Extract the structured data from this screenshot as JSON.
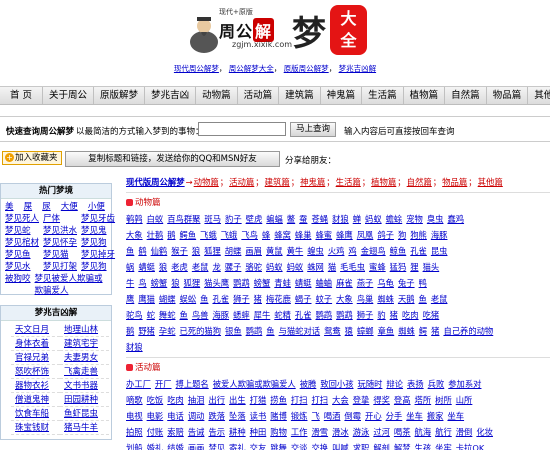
{
  "header": {
    "logo_tagline": "现代+原版",
    "logo_name_a": "周公",
    "logo_name_b": "解",
    "logo_meng": "梦",
    "logo_url": "zgjm.xixik.com",
    "seal_text_1": "大",
    "seal_text_2": "全",
    "subnav": [
      "现代周公解梦",
      "周公解梦大全",
      "原版周公解梦",
      "梦兆吉凶解"
    ],
    "subnav_sep": "，"
  },
  "nav": {
    "items": [
      "首 页",
      "关于周公",
      "原版解梦",
      "梦兆吉凶",
      "动物篇",
      "活动篇",
      "建筑篇",
      "神鬼篇",
      "生活篇",
      "植物篇",
      "自然篇",
      "物品篇",
      "其他篇"
    ]
  },
  "search": {
    "label": "快速查询周公解梦",
    "description": "以最简洁的方式输入梦到的事物：",
    "input_value": "",
    "button_label": "马上查询",
    "tip": "输入内容后可直接按回车查询"
  },
  "actions": {
    "favorite_plus": "+",
    "favorite_label": "加入收藏夹",
    "copy_label": "复制标题和链接，发送给你的QQ和MSN好友",
    "share_label": "分享给朋友："
  },
  "sidebar": {
    "hot_title": "热门梦境",
    "hot_items": [
      "美",
      "屎",
      "尿",
      "大便",
      "小便",
      "梦见死人",
      "尸体",
      "梦见牙齿",
      "梦见蛇",
      "梦见洪水",
      "梦见鬼",
      "梦见棺材",
      "梦见怀孕",
      "梦见狗",
      "梦见鱼",
      "梦见猫",
      "梦见掉牙",
      "梦见水",
      "梦见打架",
      "梦见狗",
      "被狗咬",
      "梦见被爱人欺骗或欺骗爱人"
    ],
    "omen_title": "梦兆吉凶解",
    "omen_items": [
      "天文日月",
      "地理山林",
      "身体衣着",
      "建筑宅宇",
      "官禄兄弟",
      "夫妻男女",
      "怒吹杯饰",
      "飞禽走兽",
      "器物衣衫",
      "文书书器",
      "僧道鬼神",
      "田园耕种",
      "饮食车船",
      "鱼虾昆虫",
      "珠宝钱财",
      "猪马牛羊"
    ]
  },
  "main": {
    "top_heading": "现代版周公解梦",
    "top_arrow": "→",
    "top_links": [
      "动物篇",
      "活动篇",
      "建筑篇",
      "神鬼篇",
      "生活篇",
      "植物篇",
      "自然篇",
      "物品篇",
      "其他篇"
    ],
    "top_sep": "；",
    "animal_title": "动物篇",
    "animal_rows": [
      [
        "鹌鹑",
        "白蚁",
        "百鸟群聚",
        "斑马",
        "豹子",
        "壁虎",
        "蝙蝠",
        "鳖",
        "蚕",
        "苍蝇",
        "豺狼",
        "蝉",
        "蚂蚁",
        "蟾蜍",
        "宠物",
        "臭虫",
        "蠢鸡"
      ],
      [
        "大象",
        "壮鹅",
        "鹅",
        "鳄鱼",
        "飞蛾",
        "飞蛾",
        "飞鸟",
        "蜂",
        "蜂窝",
        "蜂巢",
        "蜂蜜",
        "蜂鹰",
        "凤凰",
        "鸽子",
        "狗",
        "狗熊",
        "海豚"
      ],
      [
        "鱼",
        "鹤",
        "仙鹤",
        "猴子",
        "狼",
        "狐狸",
        "胡蝶",
        "画眉",
        "黄鼠",
        "黄牛",
        "蝗虫",
        "火鸡",
        "鸡",
        "金翅鸟",
        "鲸鱼",
        "孔雀",
        "昆虫"
      ],
      [
        "蜗",
        "蜻蜓",
        "狼",
        "老虎",
        "老鼠",
        "龙",
        "骡子",
        "骆驼",
        "蚂蚁",
        "蚂蚁",
        "蛛网",
        "猫",
        "毛毛虫",
        "蜜蜂",
        "猛犸",
        "狸",
        "猫头"
      ],
      [
        "牛",
        "鸟",
        "螃蟹",
        "狼",
        "狐狸",
        "猫头鹰",
        "鹦鹉",
        "螃蟹",
        "青蛙",
        "蜻蜓",
        "蛐蛐",
        "麻雀",
        "燕子",
        "乌龟",
        "兔子",
        "鸭"
      ],
      [
        "鹰",
        "鹰猫",
        "蝴蝶",
        "蜈蚣",
        "鱼",
        "孔雀",
        "狮子",
        "猪",
        "梅花鹿",
        "蝎子",
        "蚊子",
        "大象",
        "鸟巢",
        "蜘蛛",
        "天鹅",
        "鱼",
        "老鼠"
      ],
      [
        "驼鸟",
        "蛇",
        "舞蛇",
        "鱼",
        "鸟兽",
        "海豚",
        "蟋蟀",
        "犀牛",
        "蛇精",
        "孔雀",
        "鹦鹉",
        "鹦鹉",
        "狮子",
        "豹",
        "猪",
        "吃肉",
        "吃猪"
      ],
      [
        "鹅",
        "野猪",
        "孕蛇",
        "已死的猫狗",
        "银鱼",
        "鹦鹉",
        "鱼",
        "与猫蛇对话",
        "鸳鸯",
        "猿",
        "蟑螂",
        "章鱼",
        "蜘蛛",
        "鳄",
        "猪",
        "自己养的动物"
      ],
      [
        "豺狼"
      ]
    ],
    "activity_title": "活动篇",
    "activity_rows": [
      [
        "办工厂",
        "开厂",
        "搏上题名",
        "被爱人欺骗或欺骗爱人",
        "被腾",
        "致回小孩",
        "玩随时",
        "辩论",
        "表扬",
        "兵败",
        "参加系对"
      ],
      [
        "嘀歌",
        "吃饭",
        "吃肉",
        "抽泪",
        "出行",
        "出生",
        "打猎",
        "捞鱼",
        "打扫",
        "打扫",
        "大会",
        "登挚",
        "得奖",
        "登高",
        "塔所",
        "树所",
        "山所"
      ],
      [
        "电视",
        "电影",
        "电话",
        "调动",
        "跌落",
        "坠落",
        "读书",
        "赌博",
        "锻炼",
        "飞",
        "喝酒",
        "倒霉",
        "开心",
        "分手",
        "坐车",
        "搬家",
        "坐车"
      ],
      [
        "拍照",
        "付账",
        "索赔",
        "告诫",
        "告示",
        "耕种",
        "种田",
        "购物",
        "工作",
        "滑雪",
        "滑冰",
        "游泳",
        "过河",
        "喝茶",
        "航海",
        "航行",
        "滑倒",
        "化妆"
      ],
      [
        "划船",
        "婚礼",
        "结婚",
        "画画",
        "梦见",
        "寄礼",
        "交友",
        "跳舞",
        "交谈",
        "交换",
        "叫喊",
        "求职",
        "解剖",
        "解梦",
        "生孩",
        "坐牢",
        "卡拉OK"
      ],
      [
        "驴开车",
        "开飞机",
        "开除",
        "开炮",
        "开汽车",
        "开会",
        "教授",
        "考试",
        "看书",
        "看戏",
        "看电影",
        "去动物园",
        "考生",
        "考试",
        "唱歌",
        "叩头",
        "磕头"
      ]
    ]
  }
}
